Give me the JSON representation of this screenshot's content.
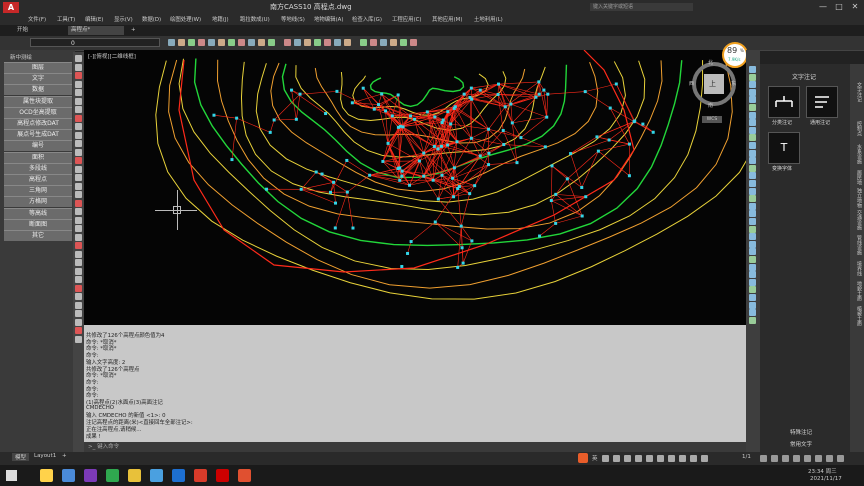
{
  "app": {
    "logo": "A",
    "title": "南方CASS10    高程点.dwg",
    "search_placeholder": "键入关键字或短语"
  },
  "menu": [
    "文件(F)",
    "工具(T)",
    "编辑(E)",
    "显示(V)",
    "数据(D)",
    "绘图处理(W)",
    "地籍(J)",
    "跑拉数成(U)",
    "等地线(S)",
    "地物编辑(A)",
    "检查入库(G)",
    "工程应用(C)",
    "其他应用(M)",
    "土地利用(L)"
  ],
  "tabs": {
    "start": "开始",
    "active": "高程点*",
    "add": "+"
  },
  "toolbar": {
    "layer": "0"
  },
  "left_panel": {
    "title": "新中测绘",
    "items": [
      "图层",
      "文字",
      "数据",
      "属性块提取",
      "OCD坐高提取",
      "高程点修改DAT",
      "展点号生成DAT",
      "编号",
      "面积",
      "多段线",
      "高程点",
      "三角网",
      "方格网",
      "等高线",
      "断面图",
      "其它"
    ]
  },
  "view_label": "[-][俯视][二维线框]",
  "compass": {
    "north": "北",
    "south": "南",
    "east": "东",
    "west": "西",
    "top": "上",
    "wcs": "WCS"
  },
  "zoom_badge": {
    "value": "89",
    "unit": "%",
    "speed": "7.9K/s"
  },
  "command_history": [
    "共修改了126个高程点颜色值为4",
    "命令: *取消*",
    "命令: *取消*",
    "命令:",
    "输入文字高度: 2",
    "共修改了126个高程点",
    "命令: *取消*",
    "命令:",
    "命令:",
    "命令:",
    "(1)高程点(2)水面点(3)高面注记",
    "CMDECHO",
    "输入 CMDECHO 的新值 <1>: 0",
    "注记高程点的距离(米)<直接回车全部注记>:",
    "正在注高程点,请稍候...",
    "成果 !"
  ],
  "command_input_placeholder": "键入命令",
  "right_panel": {
    "title": "文字注记",
    "buttons": [
      {
        "label": "分类注记",
        "icon": "tree-icon"
      },
      {
        "label": "通用注记",
        "icon": "text-lines-icon"
      },
      {
        "label": "变换字体",
        "icon": "T"
      }
    ],
    "bottom_items": [
      "特殊注记",
      "常用文字"
    ],
    "vertical_tabs": [
      "文字注记",
      "控制点",
      "水系设施",
      "居民地",
      "独立地物",
      "交通设施",
      "管线设施",
      "境界线",
      "地貌土质",
      "植被土质"
    ]
  },
  "layout_tabs": [
    "模型",
    "Layout1",
    "+"
  ],
  "taskbar": {
    "ime": "英",
    "time": "23:34 周三",
    "date": "2021/11/17",
    "page": "1/1"
  },
  "colors": {
    "contour_red": "#ff2a1a",
    "contour_yellow": "#e8d23a",
    "contour_green": "#22d63a",
    "contour_orange": "#f0a030",
    "point_cyan": "#33d6e8"
  }
}
